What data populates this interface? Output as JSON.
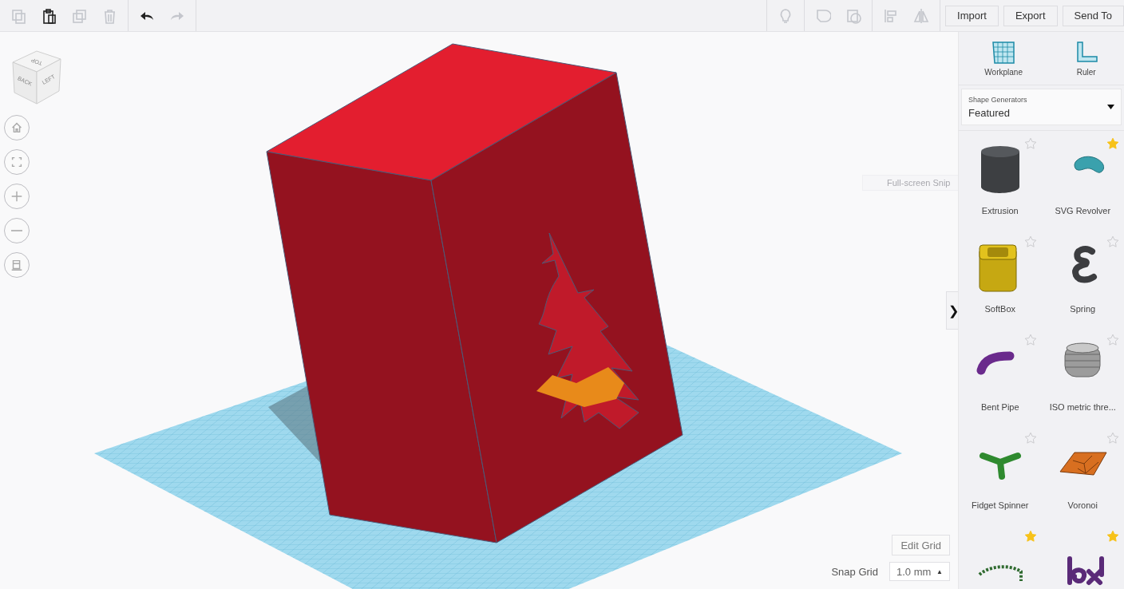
{
  "toolbar": {
    "left_tools": [
      {
        "kind": "copy",
        "disabled": true
      },
      {
        "kind": "paste",
        "disabled": false
      },
      {
        "kind": "duplicate",
        "disabled": true
      },
      {
        "kind": "delete",
        "disabled": true
      },
      {
        "kind": "undo",
        "disabled": false
      },
      {
        "kind": "redo",
        "disabled": true
      }
    ],
    "right_tools": [
      {
        "kind": "bulb",
        "disabled": true
      },
      {
        "kind": "group",
        "disabled": true
      },
      {
        "kind": "ungroup",
        "disabled": true
      },
      {
        "kind": "align",
        "disabled": true
      },
      {
        "kind": "mirror",
        "disabled": true
      }
    ],
    "buttons": [
      "Import",
      "Export",
      "Send To"
    ]
  },
  "view_cube": {
    "top": "TOP",
    "front": "BACK",
    "side": "LEFT"
  },
  "view_controls": [
    {
      "kind": "home"
    },
    {
      "kind": "fit"
    },
    {
      "kind": "zoomin"
    },
    {
      "kind": "zoomout"
    },
    {
      "kind": "ortho"
    }
  ],
  "tooltip": "Full-screen Snip",
  "edit_grid": "Edit Grid",
  "snap_grid": {
    "label": "Snap Grid",
    "value": "1.0 mm",
    "caret": "▲"
  },
  "panel_toggle": "❯",
  "panel": {
    "tools": [
      {
        "kind": "workplane",
        "label": "Workplane"
      },
      {
        "kind": "ruler",
        "label": "Ruler"
      }
    ],
    "library": {
      "label": "Shape Generators",
      "value": "Featured"
    },
    "shapes": [
      {
        "kind": "cylinder",
        "label": "Extrusion",
        "selected": false
      },
      {
        "kind": "ring",
        "label": "SVG Revolver",
        "selected": true
      },
      {
        "kind": "softbox",
        "label": "SoftBox",
        "selected": false
      },
      {
        "kind": "spring",
        "label": "Spring",
        "selected": false
      },
      {
        "kind": "pipe",
        "label": "Bent Pipe",
        "selected": false
      },
      {
        "kind": "thread",
        "label": "ISO metric thre...",
        "selected": false
      },
      {
        "kind": "spinner",
        "label": "Fidget Spinner",
        "selected": false
      },
      {
        "kind": "tile",
        "label": "Voronoi",
        "selected": false
      },
      {
        "kind": "arc",
        "selected": true
      },
      {
        "kind": "glyphs",
        "selected": true
      }
    ]
  }
}
